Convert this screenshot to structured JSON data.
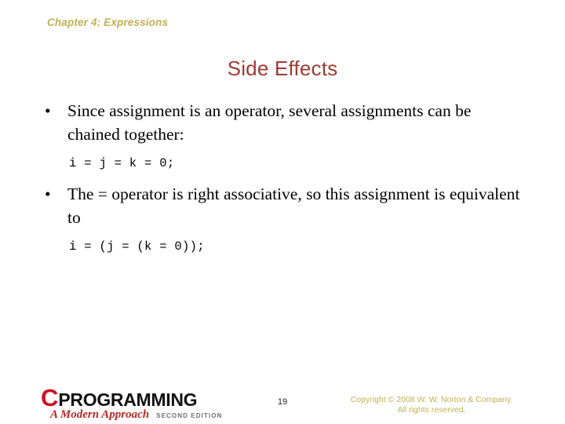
{
  "slide": {
    "header": "Chapter 4: Expressions",
    "title": "Side Effects",
    "page_number": "19",
    "colors": {
      "background": "#ffffff",
      "header_text": "#C1B053",
      "title_text": "#9E3B33",
      "body_text": "#000000",
      "logo_c": "#CC1122",
      "logo_wordmark": "#111111",
      "logo_subtitle": "#B52A25",
      "logo_edition": "#6E6E6E",
      "copyright_text": "#C1B053"
    }
  },
  "content": {
    "blocks": [
      {
        "kind": "bullet",
        "marker": "•",
        "text": "Since assignment is an operator, several assignments can be chained together:"
      },
      {
        "kind": "code",
        "text": "i = j = k = 0;"
      },
      {
        "kind": "bullet",
        "marker": "•",
        "text": "The = operator is right associative, so this assignment is equivalent to"
      },
      {
        "kind": "code",
        "text": "i = (j = (k = 0));"
      }
    ]
  },
  "footer": {
    "logo": {
      "letter": "C",
      "wordmark": "PROGRAMMING",
      "subtitle": "A Modern Approach",
      "edition": "SECOND EDITION"
    },
    "copyright_line1": "Copyright © 2008 W. W. Norton & Company.",
    "copyright_line2": "All rights reserved."
  }
}
